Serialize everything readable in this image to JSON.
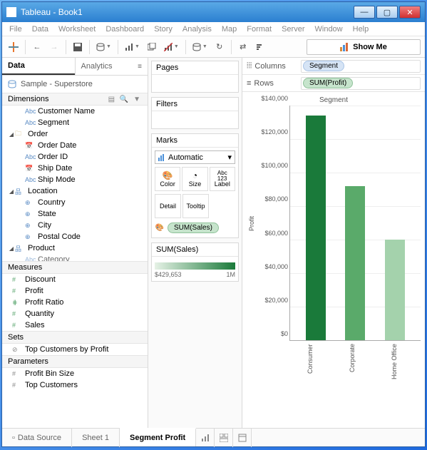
{
  "window": {
    "title": "Tableau - Book1"
  },
  "menubar": [
    "File",
    "Data",
    "Worksheet",
    "Dashboard",
    "Story",
    "Analysis",
    "Map",
    "Format",
    "Server",
    "Window",
    "Help"
  ],
  "showme": "Show Me",
  "data_panel": {
    "tabs": [
      "Data",
      "Analytics"
    ],
    "source": "Sample - Superstore",
    "sections": {
      "dimensions": "Dimensions",
      "measures": "Measures",
      "sets": "Sets",
      "parameters": "Parameters"
    },
    "dimensions": {
      "customer_name": "Customer Name",
      "segment": "Segment",
      "order": "Order",
      "order_date": "Order Date",
      "order_id": "Order ID",
      "ship_date": "Ship Date",
      "ship_mode": "Ship Mode",
      "location": "Location",
      "country": "Country",
      "state": "State",
      "city": "City",
      "postal_code": "Postal Code",
      "product": "Product",
      "category": "Category"
    },
    "measures": {
      "discount": "Discount",
      "profit": "Profit",
      "profit_ratio": "Profit Ratio",
      "quantity": "Quantity",
      "sales": "Sales"
    },
    "sets": {
      "top_customers": "Top Customers by Profit"
    },
    "parameters": {
      "profit_bin": "Profit Bin Size",
      "top_customers": "Top Customers"
    }
  },
  "mid": {
    "pages": "Pages",
    "filters": "Filters",
    "marks": "Marks",
    "marks_type": "Automatic",
    "cells": {
      "color": "Color",
      "size": "Size",
      "label": "Label",
      "detail": "Detail",
      "tooltip": "Tooltip"
    },
    "pill": "SUM(Sales)",
    "legend_title": "SUM(Sales)",
    "legend_min": "$429,653",
    "legend_max": "1M"
  },
  "shelves": {
    "columns_label": "Columns",
    "rows_label": "Rows",
    "columns_pill": "Segment",
    "rows_pill": "SUM(Profit)"
  },
  "bottom": {
    "datasource": "Data Source",
    "sheet1": "Sheet 1",
    "active": "Segment Profit"
  },
  "chart_data": {
    "type": "bar",
    "title": "Segment",
    "ylabel": "Profit",
    "xlabel": "",
    "ylim": [
      0,
      140000
    ],
    "categories": [
      "Consumer",
      "Corporate",
      "Home Office"
    ],
    "values": [
      134000,
      92000,
      60000
    ],
    "colors": [
      "#1a7a3a",
      "#5aaa6a",
      "#a4d2ac"
    ],
    "yticks": [
      "$0",
      "$20,000",
      "$40,000",
      "$60,000",
      "$80,000",
      "$100,000",
      "$120,000",
      "$140,000"
    ]
  }
}
